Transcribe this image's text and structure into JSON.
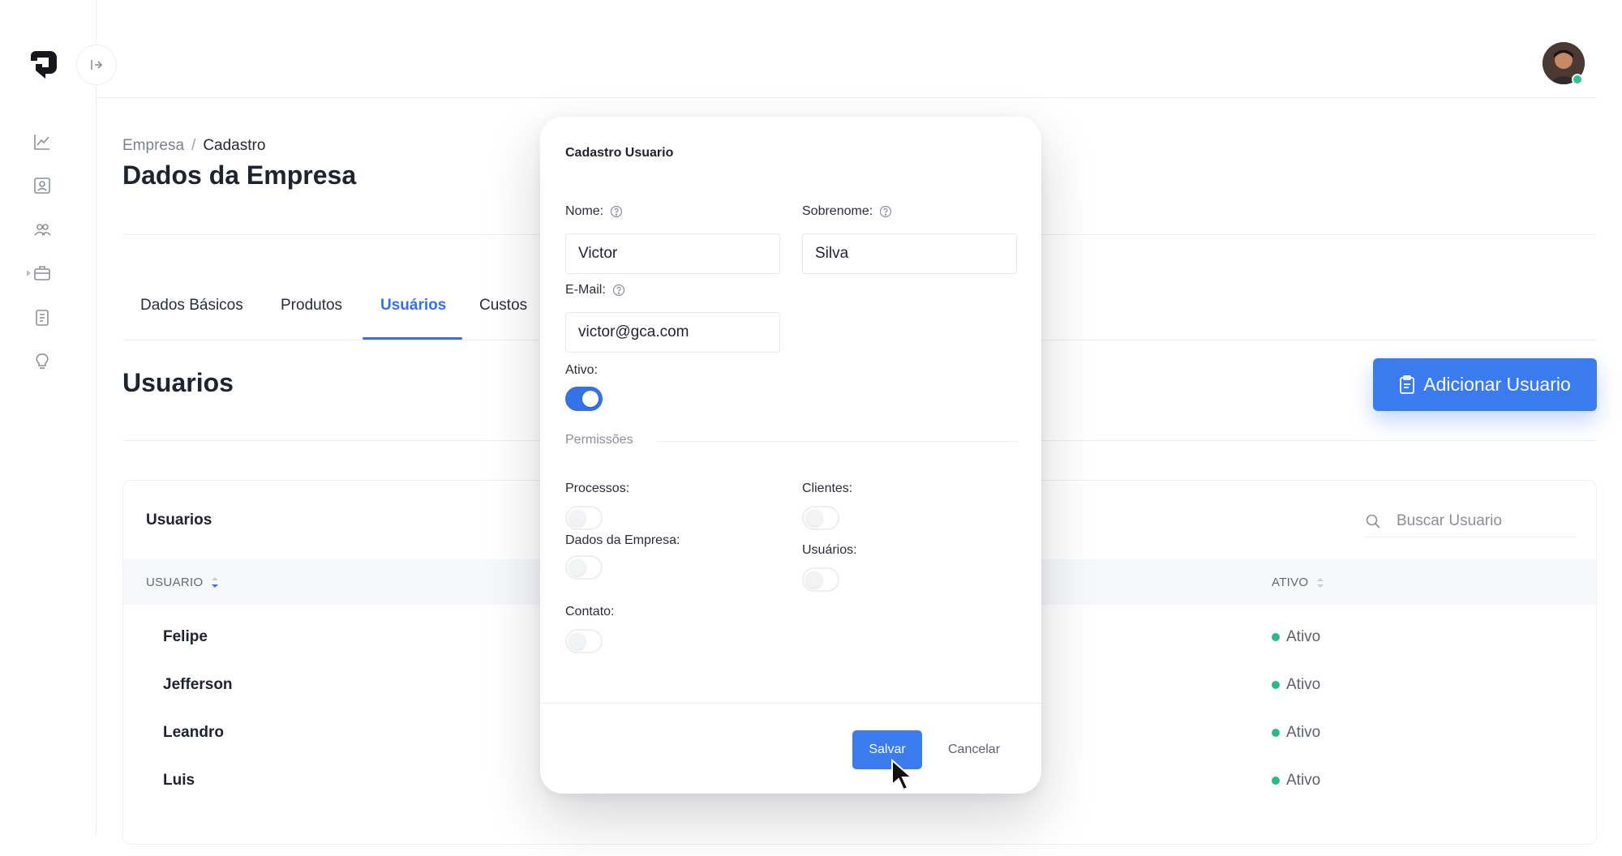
{
  "breadcrumb": {
    "parent": "Empresa",
    "separator": "/",
    "current": "Cadastro"
  },
  "page_title": "Dados da Empresa",
  "tabs": [
    {
      "label": "Dados Básicos"
    },
    {
      "label": "Produtos"
    },
    {
      "label": "Usuários",
      "active": true
    },
    {
      "label": "Custos"
    }
  ],
  "section_title": "Usuarios",
  "add_button": {
    "label": "Adicionar Usuario",
    "icon": "clipboard-icon"
  },
  "card": {
    "title": "Usuarios",
    "search": {
      "placeholder": "Buscar Usuario",
      "icon": "search-icon"
    },
    "columns": [
      {
        "label": "USUARIO",
        "sort": "desc"
      },
      {
        "label": "ATIVO",
        "sort": "none"
      }
    ],
    "rows": [
      {
        "name": "Felipe",
        "status": "Ativo"
      },
      {
        "name": "Jefferson",
        "status": "Ativo"
      },
      {
        "name": "Leandro",
        "status": "Ativo"
      },
      {
        "name": "Luis",
        "status": "Ativo"
      }
    ]
  },
  "modal": {
    "title": "Cadastro Usuario",
    "fields": {
      "nome": {
        "label": "Nome:",
        "value": "Victor"
      },
      "sobrenome": {
        "label": "Sobrenome:",
        "value": "Silva"
      },
      "email": {
        "label": "E-Mail:",
        "value": "victor@gca.com"
      },
      "ativo": {
        "label": "Ativo:",
        "on": true
      }
    },
    "permissions_label": "Permissões",
    "permissions": {
      "processos": {
        "label": "Processos:",
        "on": false
      },
      "clientes": {
        "label": "Clientes:",
        "on": false
      },
      "dados_empresa": {
        "label": "Dados da Empresa:",
        "on": false
      },
      "usuarios": {
        "label": "Usuários:",
        "on": false
      },
      "contato": {
        "label": "Contato:",
        "on": false
      }
    },
    "save_label": "Salvar",
    "cancel_label": "Cancelar"
  },
  "sidebar": {
    "icons": [
      "chart-line-icon",
      "user-card-icon",
      "users-icon",
      "briefcase-icon",
      "document-icon",
      "lightbulb-icon"
    ]
  },
  "colors": {
    "accent": "#3571e8",
    "button": "#3b7bf0",
    "status_active": "#2bb88a"
  }
}
